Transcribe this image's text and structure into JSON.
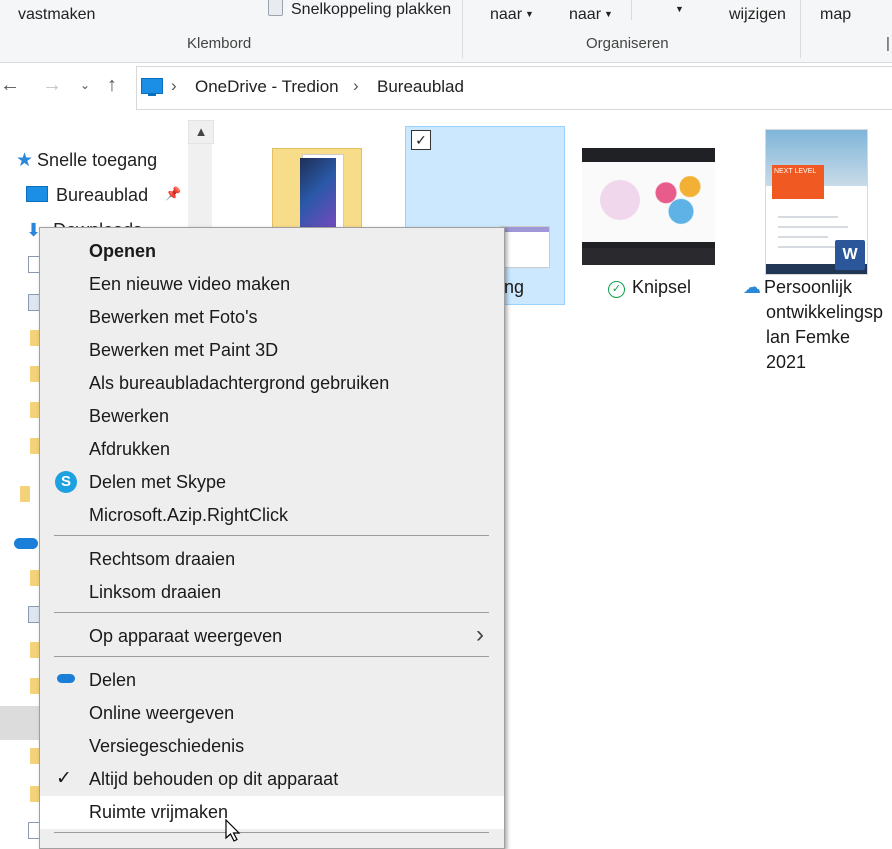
{
  "ribbon": {
    "vastmaken": "vastmaken",
    "snelkoppeling_plakken": "Snelkoppeling plakken",
    "klembord": "Klembord",
    "verplaatsen_naar": "naar",
    "kopieren_naar": "naar",
    "wijzigen": "wijzigen",
    "map": "map",
    "organiseren": "Organiseren"
  },
  "address": {
    "segments": [
      "OneDrive - Tredion",
      "Bureaublad"
    ]
  },
  "nav": {
    "quick_access": "Snelle toegang",
    "desktop": "Bureaublad",
    "downloads": "Downloads"
  },
  "files": [
    {
      "name": "ding"
    },
    {
      "name": "Knipsel"
    },
    {
      "name": "Persoonlijk ontwikkelingsplan Femke 2021",
      "lines": [
        "Persoonlijk",
        "ontwikkelingsp",
        "lan Femke",
        "2021"
      ]
    }
  ],
  "thumb": {
    "doc_badge": "NEXT LEVEL",
    "word_letter": "W"
  },
  "menu": {
    "items": [
      "Openen",
      "Een nieuwe video maken",
      "Bewerken met Foto's",
      "Bewerken met Paint 3D",
      "Als bureaubladachtergrond gebruiken",
      "Bewerken",
      "Afdrukken",
      "Delen met Skype",
      "Microsoft.Azip.RightClick",
      "Rechtsom draaien",
      "Linksom draaien",
      "Op apparaat weergeven",
      "Delen",
      "Online weergeven",
      "Versiegeschiedenis",
      "Altijd behouden op dit apparaat",
      "Ruimte vrijmaken"
    ]
  },
  "colors": {
    "accent": "#0078d4",
    "selection": "#cce8ff",
    "menu_bg": "#eeeeee"
  }
}
